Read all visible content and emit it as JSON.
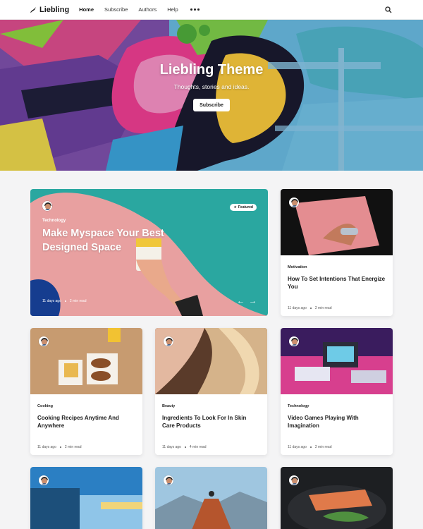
{
  "header": {
    "logo_text": "Liebling",
    "nav": [
      "Home",
      "Subscribe",
      "Authors",
      "Help"
    ],
    "active_nav": "Home"
  },
  "hero": {
    "title": "Liebling Theme",
    "subtitle": "Thoughts, stories and ideas.",
    "button_label": "Subscribe"
  },
  "featured": {
    "tag": "Technology",
    "title": "Make Myspace Your Best Designed Space",
    "badge": "Featured",
    "date": "11 days ago",
    "read_time": "2 min read"
  },
  "posts": [
    {
      "tag": "Motivation",
      "title": "How To Set Intentions That Energize You",
      "date": "11 days ago",
      "read_time": "2 min read"
    },
    {
      "tag": "Cooking",
      "title": "Cooking Recipes Anytime And Anywhere",
      "date": "11 days ago",
      "read_time": "2 min read"
    },
    {
      "tag": "Beauty",
      "title": "Ingredients To Look For In Skin Care Products",
      "date": "11 days ago",
      "read_time": "4 min read"
    },
    {
      "tag": "Technology",
      "title": "Video Games Playing With Imagination",
      "date": "11 days ago",
      "read_time": "2 min read"
    }
  ],
  "colors": {
    "featured_teal": "#2aa7a0",
    "featured_pink": "#e8a0a0",
    "hero_blue": "#5aa9d6"
  }
}
